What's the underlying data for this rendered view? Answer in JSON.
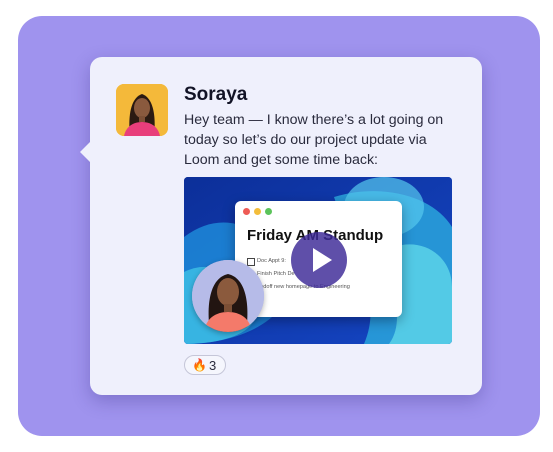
{
  "message": {
    "author": "Soraya",
    "text": "Hey team — I know there’s a lot going on today so let’s do our project update via Loom and get some time back:"
  },
  "video": {
    "title": "Friday AM Standup",
    "tasks": [
      "Doc Appt 9:",
      "Finish Pitch De",
      "andoff new homepage to Engineering"
    ]
  },
  "reaction": {
    "emoji": "🔥",
    "count": "3"
  },
  "colors": {
    "background": "#9f93ee",
    "card": "#eff0fc",
    "avatar_bg": "#f4b93a",
    "play_button": "#3c2896"
  },
  "icons": [
    "fire-emoji",
    "play-icon"
  ]
}
